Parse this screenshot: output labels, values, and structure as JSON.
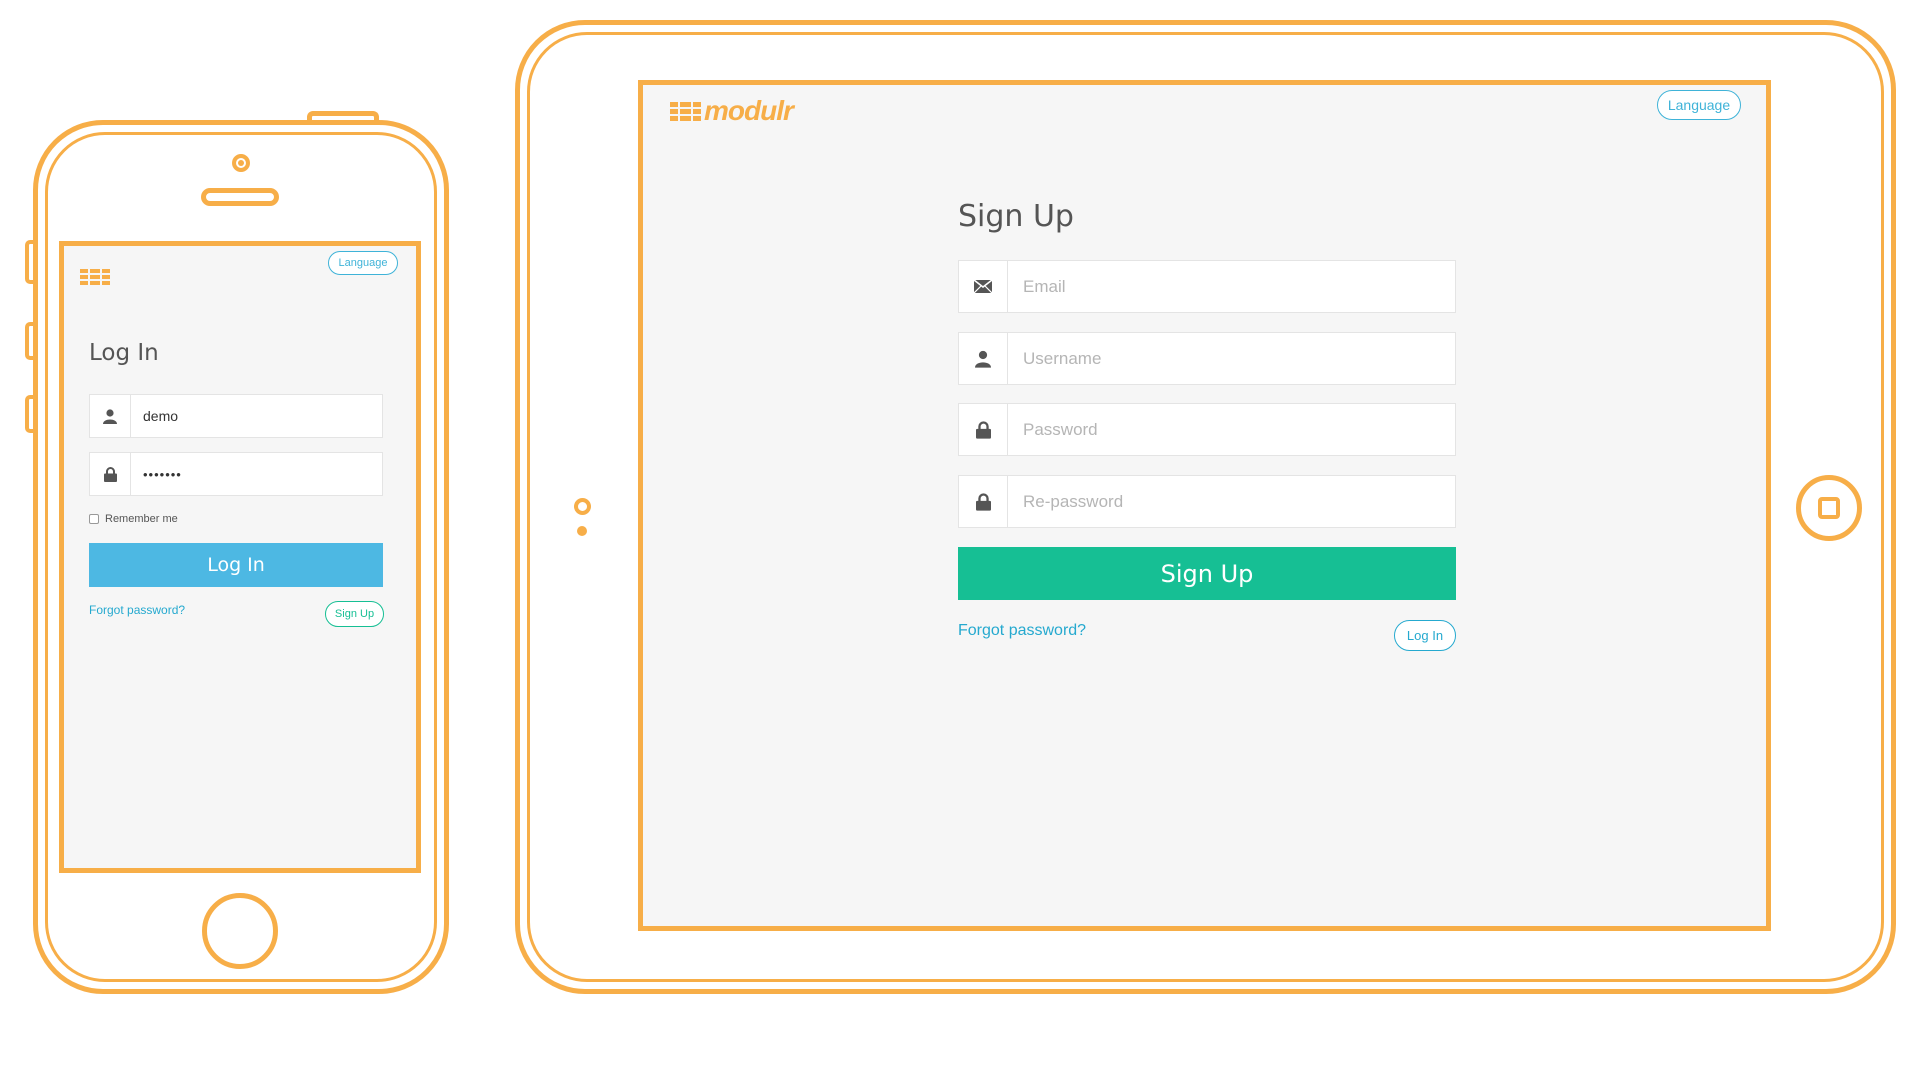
{
  "brand": {
    "name": "modulr",
    "color": "#f7ae48"
  },
  "phone": {
    "language_label": "Language",
    "title": "Log In",
    "username": {
      "value": "demo",
      "icon": "user-icon"
    },
    "password": {
      "value": "•••••••",
      "icon": "lock-icon"
    },
    "remember_label": "Remember me",
    "login_button": "Log In",
    "login_button_color": "#4db8e3",
    "forgot_link": "Forgot password?",
    "signup_pill": "Sign Up"
  },
  "tablet": {
    "language_label": "Language",
    "title": "Sign Up",
    "fields": [
      {
        "placeholder": "Email",
        "icon": "envelope-icon"
      },
      {
        "placeholder": "Username",
        "icon": "user-icon"
      },
      {
        "placeholder": "Password",
        "icon": "lock-icon"
      },
      {
        "placeholder": "Re-password",
        "icon": "lock-icon"
      }
    ],
    "signup_button": "Sign Up",
    "signup_button_color": "#16bf94",
    "forgot_link": "Forgot password?",
    "login_pill": "Log In"
  }
}
